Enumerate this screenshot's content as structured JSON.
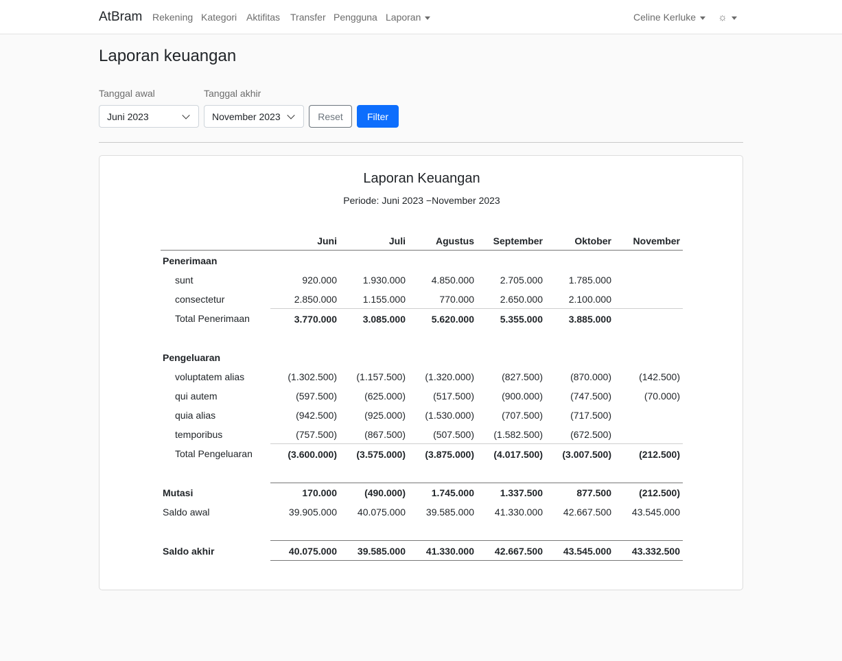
{
  "navbar": {
    "brand": "AtBram",
    "links": [
      "Rekening",
      "Kategori",
      "Aktifitas",
      "Transfer",
      "Pengguna",
      "Laporan"
    ],
    "user": "Celine Kerluke",
    "theme_icon": "sun-icon"
  },
  "page": {
    "title": "Laporan keuangan",
    "filters": {
      "start_label": "Tanggal awal",
      "start_value": "Juni 2023",
      "end_label": "Tanggal akhir",
      "end_value": "November 2023",
      "reset_label": "Reset",
      "filter_label": "Filter"
    }
  },
  "colors": {
    "primary": "#0d6efd",
    "secondary": "#6c757d",
    "background": "#fafafa"
  },
  "report": {
    "title": "Laporan Keuangan",
    "period": "Periode: Juni 2023 −November 2023",
    "months": [
      "Juni",
      "Juli",
      "Agustus",
      "September",
      "Oktober",
      "November"
    ],
    "income": {
      "heading": "Penerimaan",
      "rows": [
        {
          "name": "sunt",
          "values": [
            "920.000",
            "1.930.000",
            "4.850.000",
            "2.705.000",
            "1.785.000",
            ""
          ]
        },
        {
          "name": "consectetur",
          "values": [
            "2.850.000",
            "1.155.000",
            "770.000",
            "2.650.000",
            "2.100.000",
            ""
          ]
        }
      ],
      "total": {
        "name": "Total Penerimaan",
        "values": [
          "3.770.000",
          "3.085.000",
          "5.620.000",
          "5.355.000",
          "3.885.000",
          ""
        ]
      }
    },
    "expense": {
      "heading": "Pengeluaran",
      "rows": [
        {
          "name": "voluptatem alias",
          "values": [
            "(1.302.500)",
            "(1.157.500)",
            "(1.320.000)",
            "(827.500)",
            "(870.000)",
            "(142.500)"
          ]
        },
        {
          "name": "qui autem",
          "values": [
            "(597.500)",
            "(625.000)",
            "(517.500)",
            "(900.000)",
            "(747.500)",
            "(70.000)"
          ]
        },
        {
          "name": "quia alias",
          "values": [
            "(942.500)",
            "(925.000)",
            "(1.530.000)",
            "(707.500)",
            "(717.500)",
            ""
          ]
        },
        {
          "name": "temporibus",
          "values": [
            "(757.500)",
            "(867.500)",
            "(507.500)",
            "(1.582.500)",
            "(672.500)",
            ""
          ]
        }
      ],
      "total": {
        "name": "Total Pengeluaran",
        "values": [
          "(3.600.000)",
          "(3.575.000)",
          "(3.875.000)",
          "(4.017.500)",
          "(3.007.500)",
          "(212.500)"
        ]
      }
    },
    "mutation": {
      "name": "Mutasi",
      "values": [
        "170.000",
        "(490.000)",
        "1.745.000",
        "1.337.500",
        "877.500",
        "(212.500)"
      ]
    },
    "opening": {
      "name": "Saldo awal",
      "values": [
        "39.905.000",
        "40.075.000",
        "39.585.000",
        "41.330.000",
        "42.667.500",
        "43.545.000"
      ]
    },
    "closing": {
      "name": "Saldo akhir",
      "values": [
        "40.075.000",
        "39.585.000",
        "41.330.000",
        "42.667.500",
        "43.545.000",
        "43.332.500"
      ]
    }
  }
}
